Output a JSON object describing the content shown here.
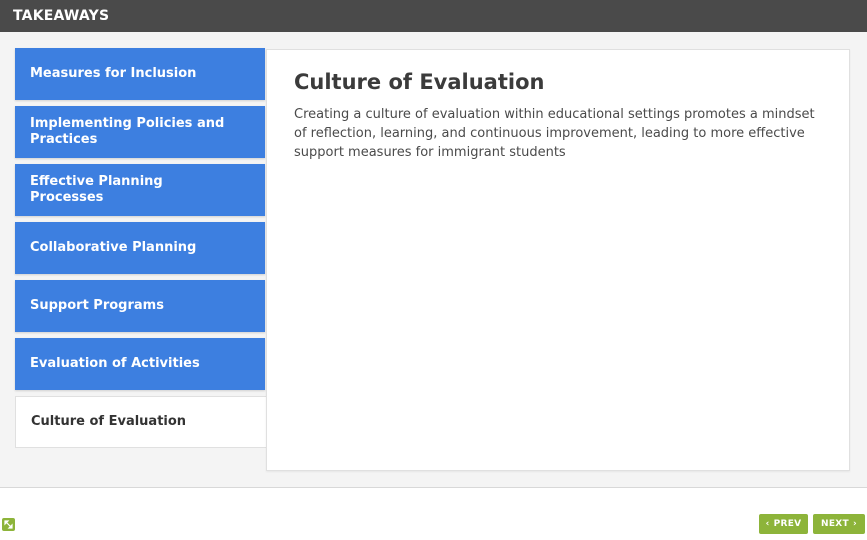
{
  "header": {
    "title": "TAKEAWAYS"
  },
  "tabs": [
    {
      "label": "Measures for Inclusion",
      "active": false
    },
    {
      "label": "Implementing Policies and Practices",
      "active": false
    },
    {
      "label": "Effective Planning Processes",
      "active": false
    },
    {
      "label": "Collaborative Planning",
      "active": false
    },
    {
      "label": "Support Programs",
      "active": false
    },
    {
      "label": "Evaluation of Activities",
      "active": false
    },
    {
      "label": "Culture of Evaluation",
      "active": true
    }
  ],
  "content": {
    "title": "Culture of Evaluation",
    "body": "Creating a culture of evaluation within educational settings promotes a mindset of reflection, learning, and continuous improvement, leading to more effective support measures for immigrant students"
  },
  "footer": {
    "expand_icon": "expand-icon",
    "prev_label": "PREV",
    "next_label": "NEXT"
  },
  "colors": {
    "header_bg": "#4a4a4a",
    "tab_bg": "#3d7fe0",
    "button_green": "#8db43a"
  }
}
